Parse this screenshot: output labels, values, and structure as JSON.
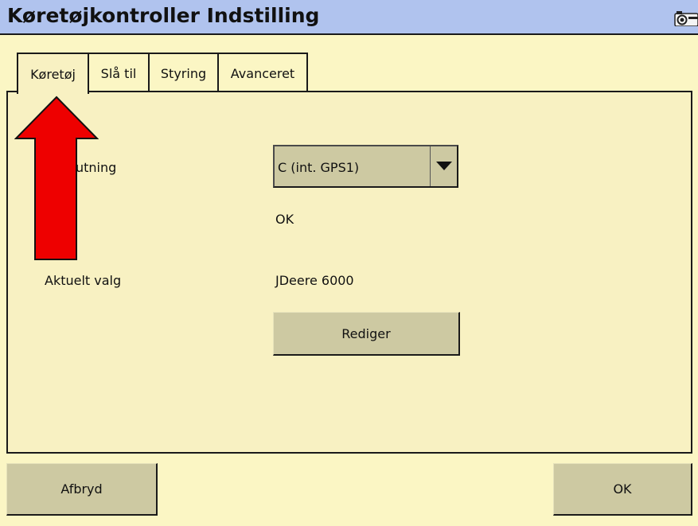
{
  "window": {
    "title": "Køretøjkontroller Indstilling"
  },
  "tabs": [
    {
      "label": "Køretøj",
      "active": true
    },
    {
      "label": "Slå til",
      "active": false
    },
    {
      "label": "Styring",
      "active": false
    },
    {
      "label": "Avanceret",
      "active": false
    }
  ],
  "panel": {
    "connection_label": "utning",
    "connection_value": "C (int. GPS1)",
    "status_value": "OK",
    "current_selection_label": "Aktuelt valg",
    "current_selection_value": "JDeere 6000",
    "edit_button": "Rediger"
  },
  "footer": {
    "cancel_button": "Afbryd",
    "ok_button": "OK"
  },
  "icons": {
    "camera": "camera-icon",
    "dropdown": "chevron-down-icon",
    "annotation": "red-arrow-up"
  },
  "colors": {
    "background": "#fbf6c4",
    "titlebar": "#b0c3ee",
    "button": "#cdc9a2",
    "arrow": "#ee0000"
  }
}
